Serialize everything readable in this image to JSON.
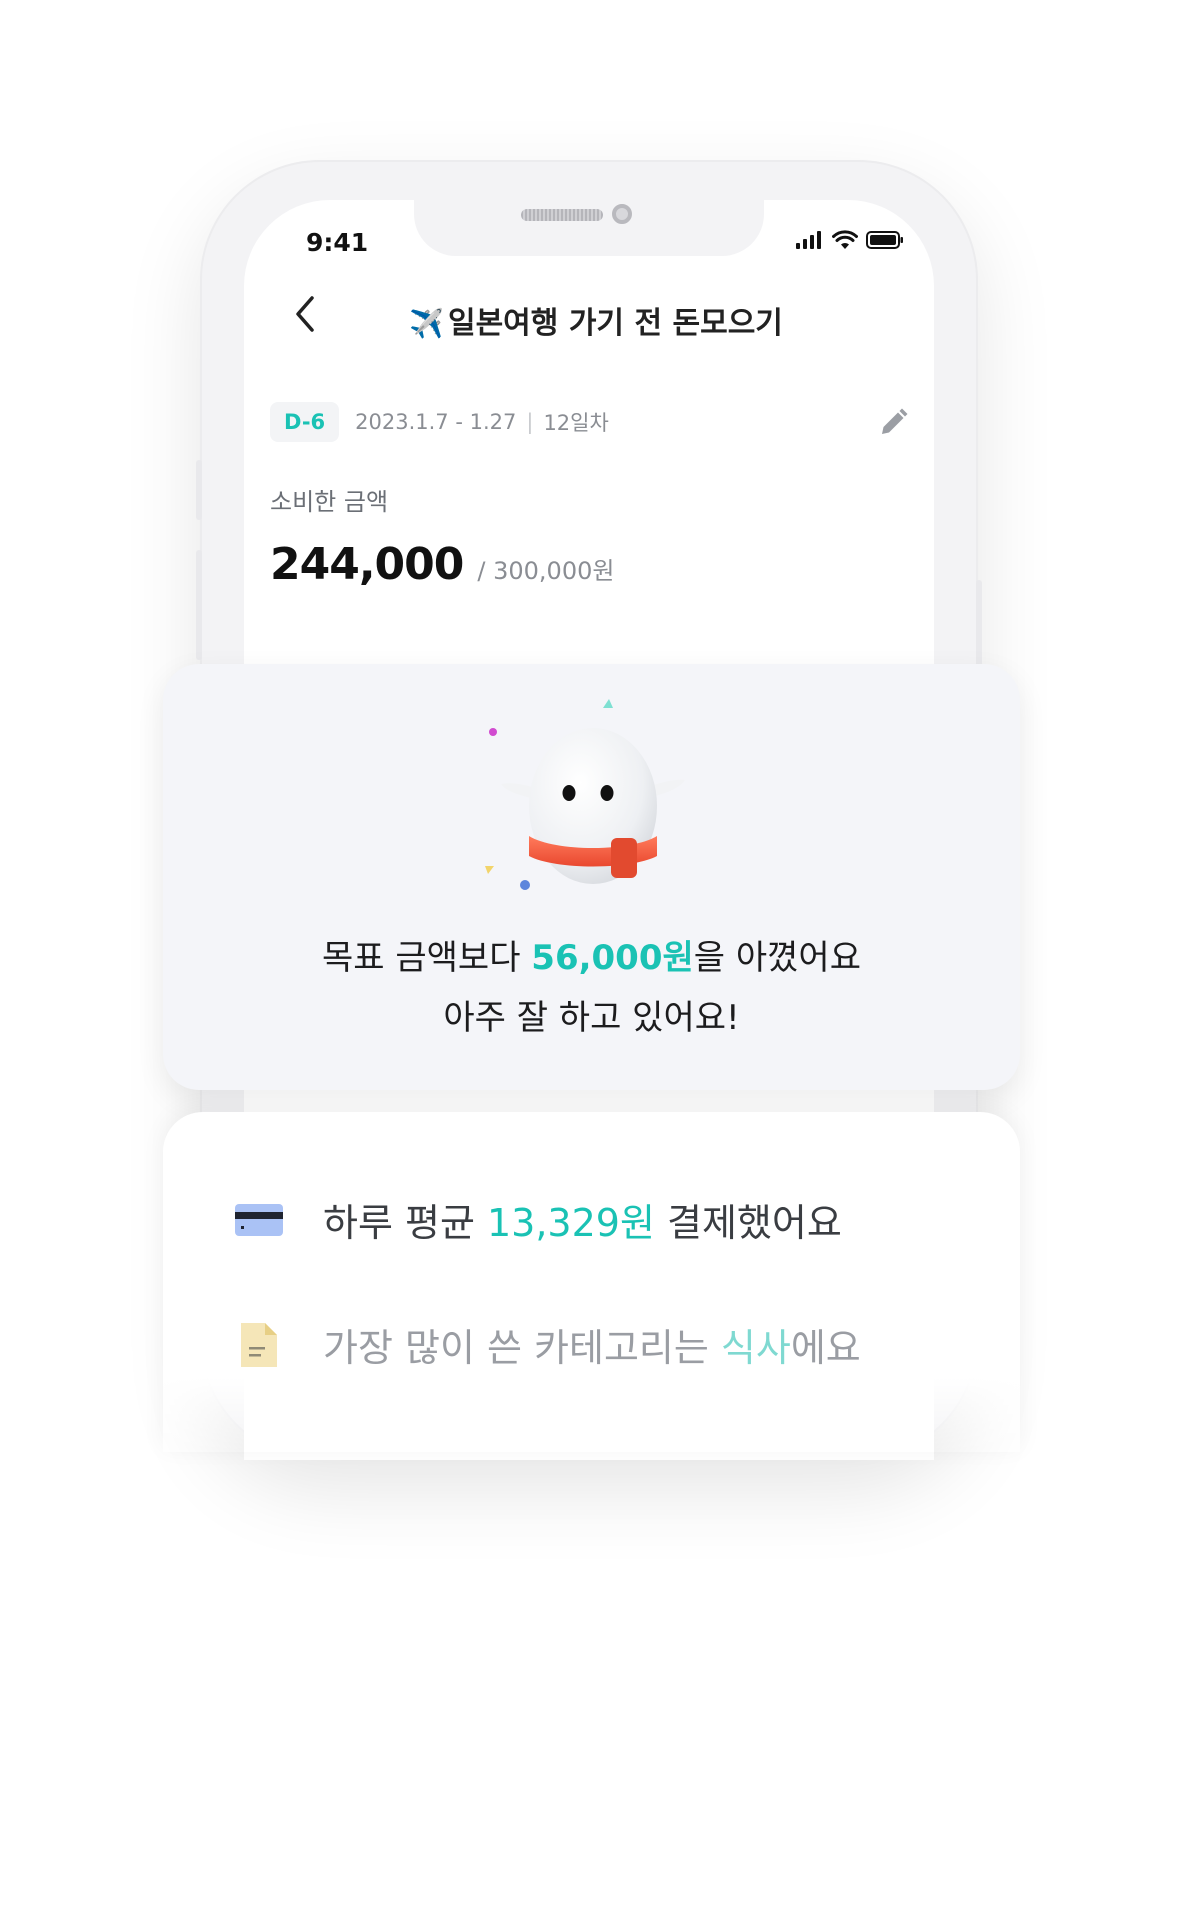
{
  "status_bar": {
    "time": "9:41"
  },
  "header": {
    "emoji": "✈️",
    "title": "일본여행 가기 전 돈모으기"
  },
  "summary": {
    "dday": "D-6",
    "period": "2023.1.7 - 1.27",
    "separator": "|",
    "day_count": "12일차",
    "spent_label": "소비한 금액",
    "spent_amount": "244,000",
    "goal": "/ 300,000원"
  },
  "saved_card": {
    "line1_prefix": "목표 금액보다 ",
    "line1_amount": "56,000원",
    "line1_suffix": "을 아꼈어요",
    "line2": "아주 잘 하고 있어요!"
  },
  "stats": [
    {
      "icon": "credit-card-icon",
      "prefix": "하루 평균 ",
      "highlight": "13,329원",
      "suffix": " 결제했어요"
    },
    {
      "icon": "document-icon",
      "prefix": "가장 많이 쓴 카테고리는 ",
      "highlight": "식사",
      "suffix": "에요"
    }
  ],
  "colors": {
    "accent": "#1ac2b4",
    "card_bg": "#f4f5f9"
  }
}
